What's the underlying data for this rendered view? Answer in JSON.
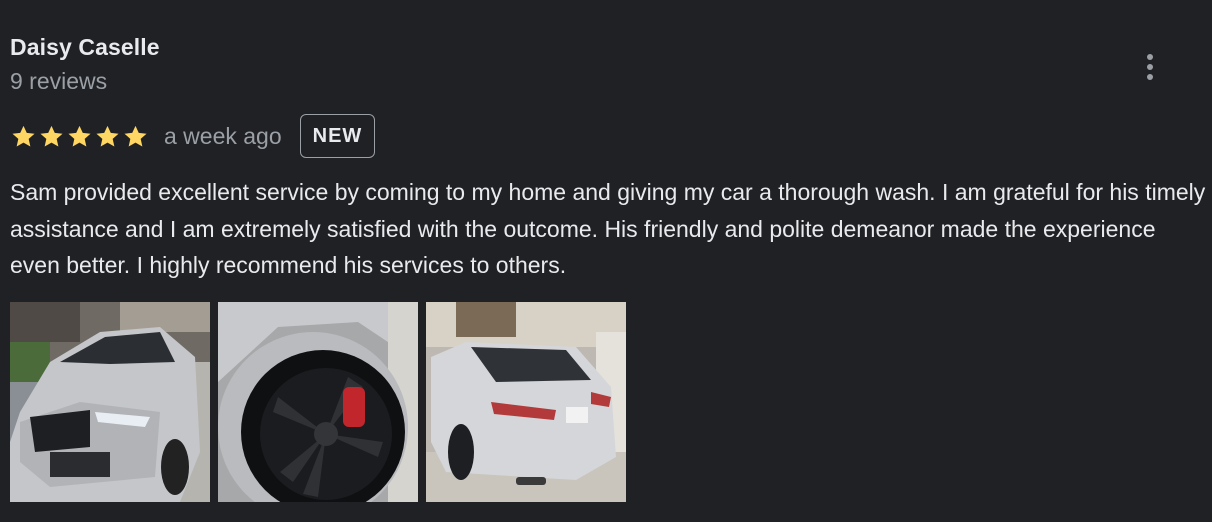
{
  "review": {
    "author_name": "Daisy Caselle",
    "author_meta": "9 reviews",
    "rating": 5,
    "rating_max": 5,
    "star_color": "#fdd663",
    "time_ago": "a week ago",
    "badge": "NEW",
    "text": "Sam provided excellent service by coming to my home and giving my car a thorough wash. I am grateful for his timely assistance and I am extremely satisfied with the outcome. His friendly and polite demeanor made the experience even better. I highly recommend his services to others.",
    "photos": [
      {
        "subject": "car-front-photo"
      },
      {
        "subject": "car-wheel-photo"
      },
      {
        "subject": "car-rear-photo"
      }
    ],
    "more_icon": "more-vert-icon"
  }
}
